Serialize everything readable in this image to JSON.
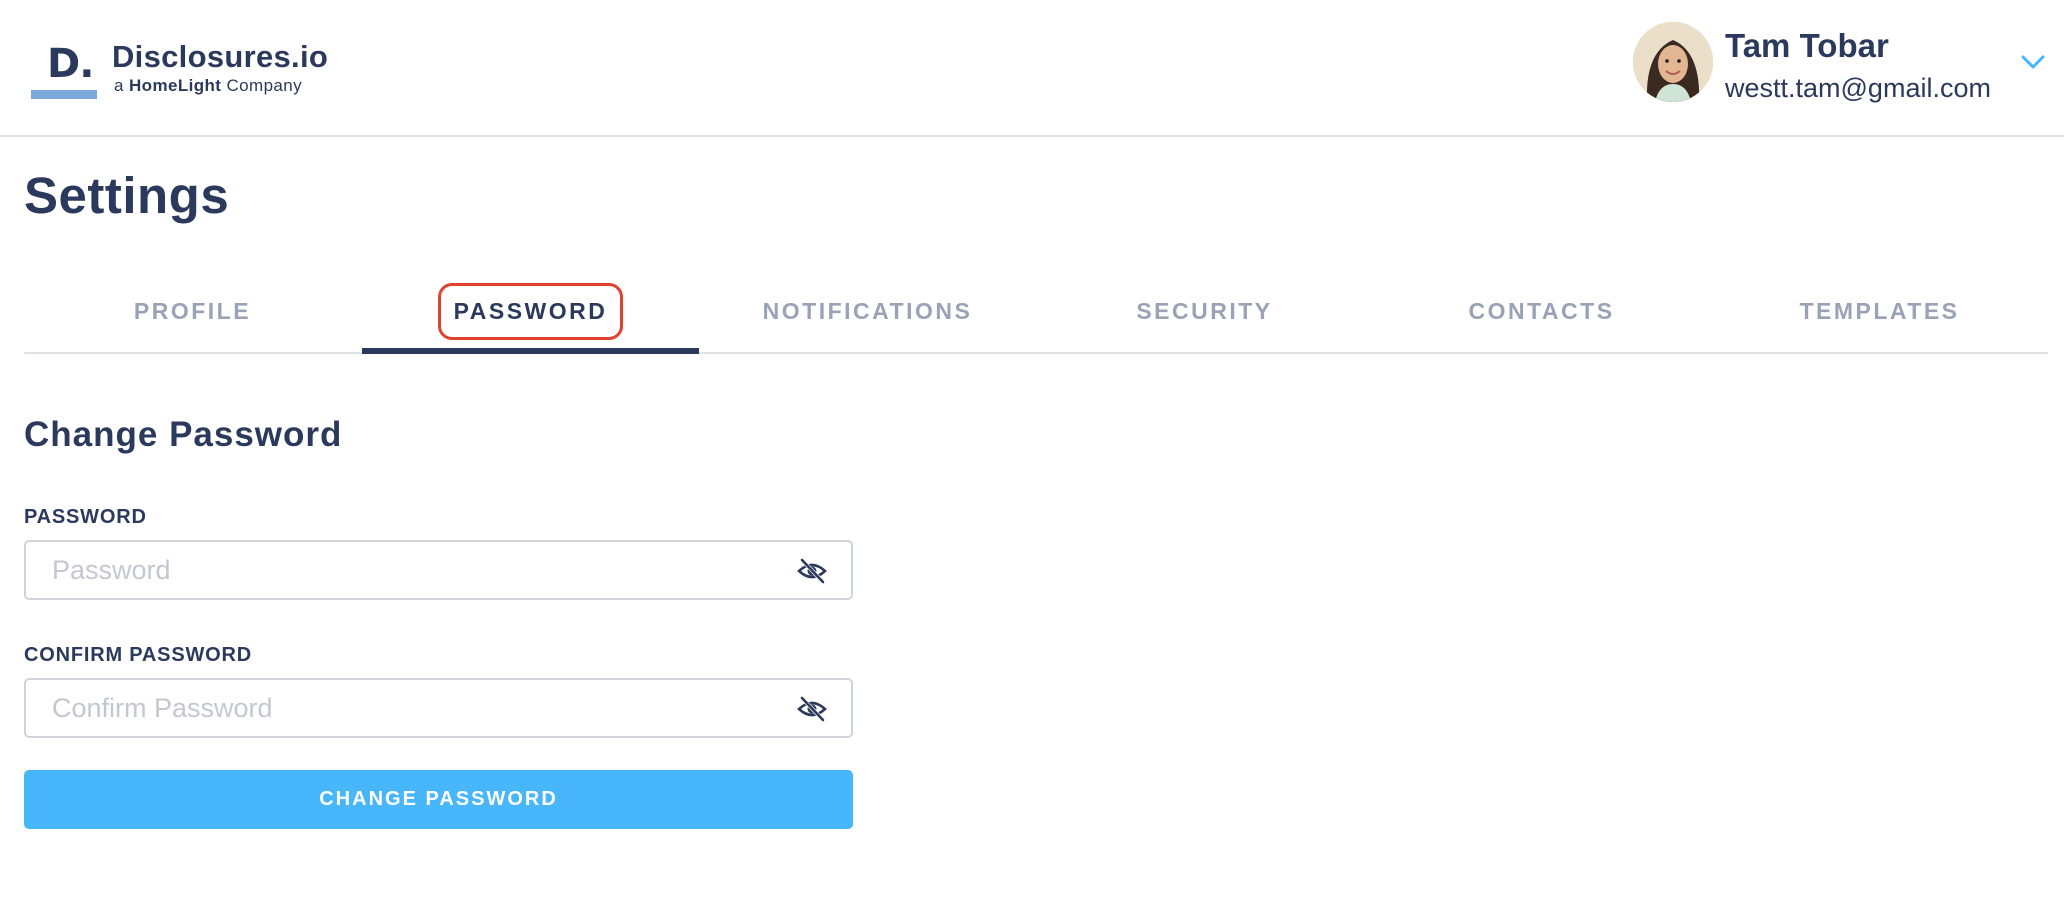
{
  "brand": {
    "mark_letter": "D.",
    "name": "Disclosures.io",
    "tagline_prefix": "a",
    "tagline_brand": "HomeLight",
    "tagline_suffix": "Company",
    "accent_color": "#7aa8d8"
  },
  "user": {
    "name": "Tam Tobar",
    "email": "westt.tam@gmail.com",
    "menu_icon": "chevron-down-icon"
  },
  "page": {
    "title": "Settings"
  },
  "tabs": [
    {
      "label": "PROFILE",
      "active": false
    },
    {
      "label": "PASSWORD",
      "active": true
    },
    {
      "label": "NOTIFICATIONS",
      "active": false
    },
    {
      "label": "SECURITY",
      "active": false
    },
    {
      "label": "CONTACTS",
      "active": false
    },
    {
      "label": "TEMPLATES",
      "active": false
    }
  ],
  "form": {
    "title": "Change Password",
    "password": {
      "label": "PASSWORD",
      "placeholder": "Password",
      "value": "",
      "toggle_icon": "eye-slash-icon"
    },
    "confirm": {
      "label": "CONFIRM PASSWORD",
      "placeholder": "Confirm Password",
      "value": "",
      "toggle_icon": "eye-slash-icon"
    },
    "submit_label": "CHANGE PASSWORD"
  },
  "colors": {
    "primary_text": "#2b3a5c",
    "inactive_tab": "#9aa3b5",
    "button": "#47b6fa",
    "focus_ring": "#e0422f"
  }
}
